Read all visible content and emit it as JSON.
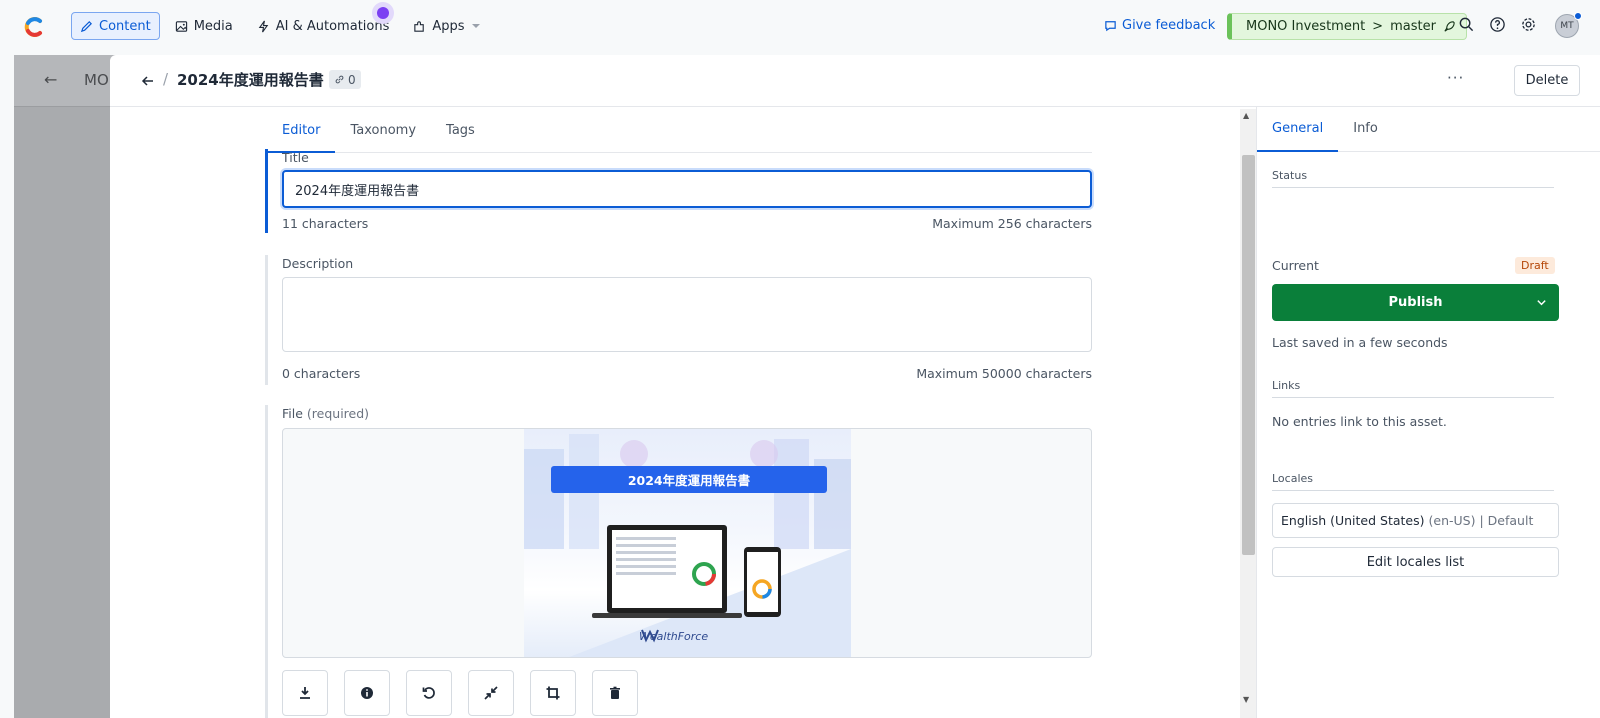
{
  "topbar": {
    "nav": [
      {
        "label": "Content",
        "icon": "pen-icon"
      },
      {
        "label": "Media",
        "icon": "image-icon"
      },
      {
        "label": "AI & Automations",
        "icon": "lightning-icon"
      },
      {
        "label": "Apps",
        "icon": "puzzle-icon"
      }
    ],
    "feedback_label": "Give feedback",
    "environment": {
      "space": "MONO Investment",
      "separator": ">",
      "branch": "master"
    },
    "avatar_initials": "MT"
  },
  "backdrop": {
    "crumb": "MOI"
  },
  "header": {
    "title": "2024年度運用報告書",
    "link_count": "0",
    "more_label": "···",
    "delete_label": "Delete"
  },
  "tabs": [
    "Editor",
    "Taxonomy",
    "Tags"
  ],
  "fields": {
    "title": {
      "label": "Title",
      "value": "2024年度運用報告書",
      "count": "11 characters",
      "max": "Maximum 256 characters"
    },
    "description": {
      "label": "Description",
      "value": "",
      "count": "0 characters",
      "max": "Maximum 50000 characters"
    },
    "file": {
      "label": "File",
      "required": "(required)",
      "preview_banner": "2024年度運用報告書",
      "preview_brand": "WealthForce"
    }
  },
  "sidebar": {
    "tabs": [
      "General",
      "Info"
    ],
    "status": {
      "heading": "Status",
      "current_label": "Current",
      "badge": "Draft",
      "publish_label": "Publish",
      "saved": "Last saved in a few seconds"
    },
    "links": {
      "heading": "Links",
      "text": "No entries link to this asset."
    },
    "locales": {
      "heading": "Locales",
      "locale": "English (United States)",
      "locale_code": "(en-US)",
      "locale_default": "| Default",
      "edit_label": "Edit locales list"
    }
  },
  "colors": {
    "accent": "#0b5cd5",
    "publish": "#0a7f3a",
    "draft_bg": "#fdeadb",
    "env_bg": "#e3f6dd"
  }
}
